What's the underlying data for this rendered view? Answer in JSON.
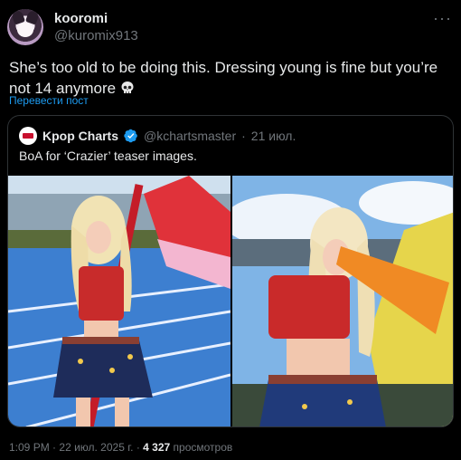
{
  "author": {
    "display_name": "kooromi",
    "handle": "@kuromix913",
    "avatar_icon": "kuromi-avatar-icon"
  },
  "tweet": {
    "text": "She’s too old to be doing this. Dressing young is fine but you’re not 14 anymore",
    "emoji_icon": "skull-icon",
    "translate_label": "Перевести пост"
  },
  "quote": {
    "display_name": "Kpop Charts",
    "handle": "@kchartsmaster",
    "separator": "·",
    "date": "21 июл.",
    "text": "BoA for ‘Crazier’ teaser images.",
    "verified_color": "#1d9bf0"
  },
  "meta": {
    "time": "1:09 PM",
    "separator": "·",
    "date": "22 июл. 2025 г.",
    "separator2": "·",
    "views_count": "4 327",
    "views_label": "просмотров"
  },
  "colors": {
    "background": "#000000",
    "text": "#e7e9ea",
    "muted": "#71767b",
    "link": "#1d9bf0",
    "border": "#2f3336"
  }
}
